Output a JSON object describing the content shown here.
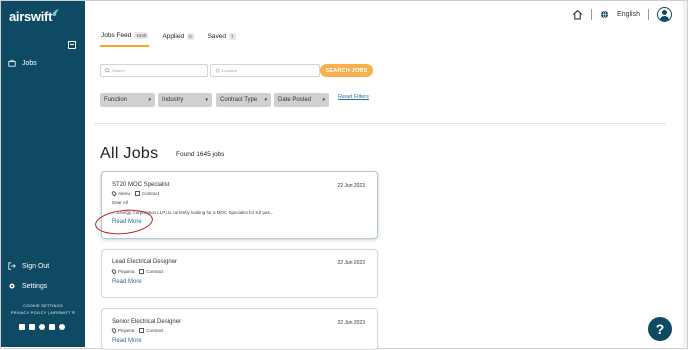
{
  "brand": {
    "name": "airswift"
  },
  "sidebar": {
    "items": [
      {
        "label": "Jobs"
      },
      {
        "label": "Sign Out"
      },
      {
        "label": "Settings"
      }
    ],
    "footer": {
      "cookie": "COOKIE SETTINGS",
      "privacy": "PRIVACY POLICY  |  AIRSWIFT ®"
    },
    "social_icons": [
      "facebook-icon",
      "linkedin-icon",
      "twitter-icon",
      "youtube-icon",
      "instagram-icon"
    ]
  },
  "header": {
    "language": "English"
  },
  "tabs": [
    {
      "label": "Jobs Feed",
      "count": "1645",
      "active": true
    },
    {
      "label": "Applied",
      "count": "0"
    },
    {
      "label": "Saved",
      "count": "7"
    }
  ],
  "search": {
    "keyword_placeholder": "Search",
    "location_placeholder": "Location",
    "button": "SEARCH JOBS"
  },
  "filters": {
    "items": [
      "Function",
      "Industry",
      "Contract Type",
      "Date Posted"
    ],
    "reset": "Reset Filters"
  },
  "main": {
    "title": "All Jobs",
    "found": "Found 1645 jobs"
  },
  "jobs": [
    {
      "title": "ST20 MOC Specialist",
      "date": "22 Jun 2023",
      "location": "Abreu",
      "contract": "Contract",
      "greeting": "Dear All",
      "snippet": "... Energy Corporation LLP) is currently looking for a MOC Specialist for KZ pas...",
      "read_more": "Read More"
    },
    {
      "title": "Lead Electrical Designer",
      "date": "22 Jun 2023",
      "location": "Pinjama",
      "contract": "Contract",
      "read_more": "Read More"
    },
    {
      "title": "Senior Electrical Designer",
      "date": "22 Jun 2023",
      "location": "Pinjama",
      "contract": "Contract",
      "read_more": "Read More"
    }
  ],
  "help": {
    "label": "?"
  },
  "colors": {
    "sidebar": "#0e4a63",
    "accent": "#f6a623",
    "link": "#2a6f9c",
    "annotation": "#c0141a"
  }
}
